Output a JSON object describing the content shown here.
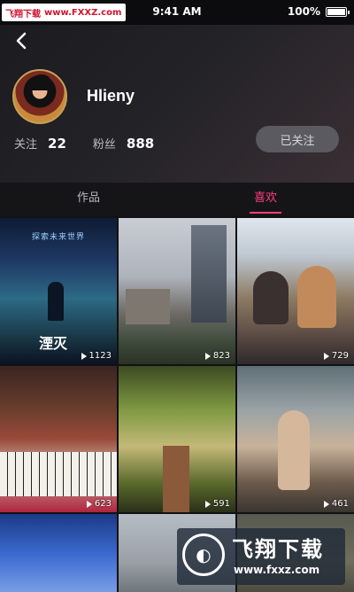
{
  "status_bar": {
    "time": "9:41 AM",
    "battery": "100%"
  },
  "watermark_top": {
    "brand": "飞翔下载",
    "url": "www.FXXZ.com"
  },
  "profile": {
    "username": "Hlieny",
    "stats": [
      {
        "label": "关注",
        "value": "22"
      },
      {
        "label": "粉丝",
        "value": "888"
      }
    ],
    "follow_button": "已关注"
  },
  "tabs": [
    {
      "label": "作品",
      "active": false
    },
    {
      "label": "喜欢",
      "active": true
    }
  ],
  "grid": {
    "items": [
      {
        "count": "1123",
        "overlay_title": "探索未来世界",
        "overlay_big": "湮灭"
      },
      {
        "count": "823"
      },
      {
        "count": "729"
      },
      {
        "count": "623"
      },
      {
        "count": "591"
      },
      {
        "count": "461"
      },
      {
        "count": ""
      },
      {
        "count": ""
      },
      {
        "count": ""
      }
    ]
  },
  "watermark_bottom": {
    "title": "飞翔下载",
    "url": "www.fxxz.com"
  },
  "colors": {
    "accent": "#ff3e7a",
    "background": "#111114",
    "follow_button_bg": "#5a5a60"
  },
  "icons": {
    "back": "chevron-left-icon",
    "play": "play-icon"
  }
}
